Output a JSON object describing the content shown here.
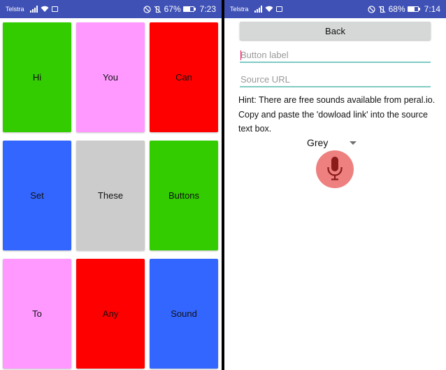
{
  "left_screen": {
    "status": {
      "carrier": "Telstra",
      "battery": "67%",
      "battery_level": 0.67,
      "time": "7:23"
    },
    "buttons": [
      {
        "label": "Hi",
        "color": "#33cc00"
      },
      {
        "label": "You",
        "color": "#ff99ff"
      },
      {
        "label": "Can",
        "color": "#ff0000"
      },
      {
        "label": "Set",
        "color": "#3366ff"
      },
      {
        "label": "These",
        "color": "#cccccc"
      },
      {
        "label": "Buttons",
        "color": "#33cc00"
      },
      {
        "label": "To",
        "color": "#ff99ff"
      },
      {
        "label": "Any",
        "color": "#ff0000"
      },
      {
        "label": "Sound",
        "color": "#3366ff"
      }
    ]
  },
  "right_screen": {
    "status": {
      "carrier": "Telstra",
      "battery": "68%",
      "battery_level": 0.68,
      "time": "7:14"
    },
    "back_label": "Back",
    "button_label_field": {
      "placeholder": "Button label",
      "value": ""
    },
    "source_url_field": {
      "placeholder": "Source URL",
      "value": ""
    },
    "hint_text": "Hint: There are free sounds available from peral.io. Copy and paste the 'dowload link' into the source text box.",
    "color_select": {
      "selected": "Grey"
    },
    "mic_icon": "microphone-icon"
  },
  "colors": {
    "status_bar": "#3f51b5",
    "field_underline": "#80cbc4",
    "mic_button": "#ee8080",
    "mic_glyph": "#8b1a1a"
  }
}
